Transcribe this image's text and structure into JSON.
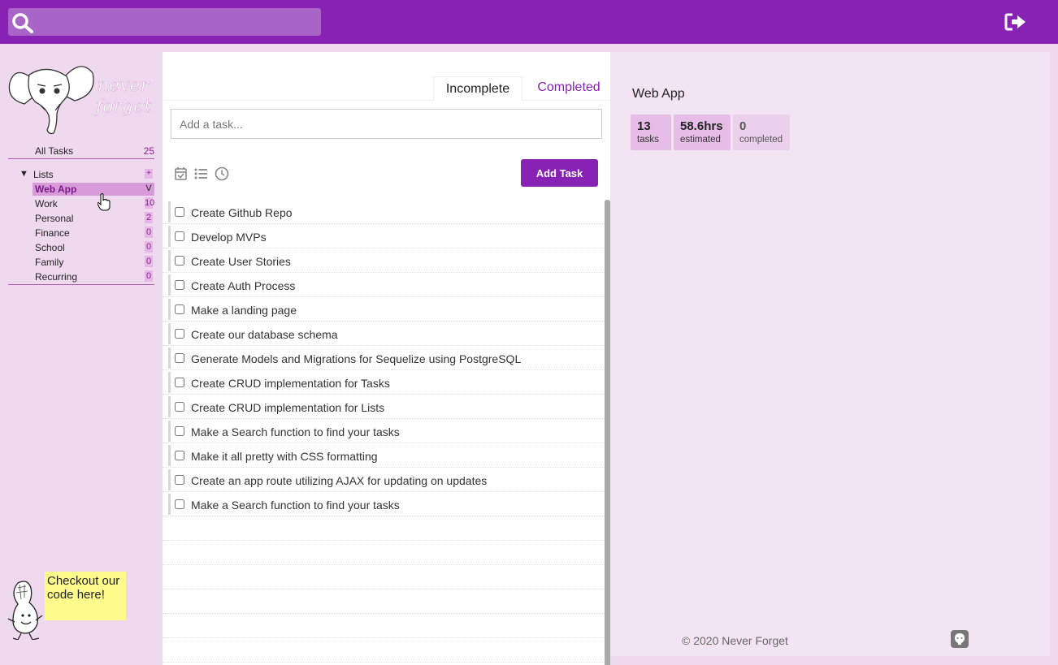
{
  "search": {
    "placeholder": ""
  },
  "sidebar": {
    "logo_text": [
      "never",
      "forget"
    ],
    "all_tasks": {
      "label": "All Tasks",
      "count": "25"
    },
    "lists_label": "Lists",
    "add_list": "+",
    "items": [
      {
        "label": "Web App",
        "count": "V"
      },
      {
        "label": "Work",
        "count": "10"
      },
      {
        "label": "Personal",
        "count": "2"
      },
      {
        "label": "Finance",
        "count": "0"
      },
      {
        "label": "School",
        "count": "0"
      },
      {
        "label": "Family",
        "count": "0"
      },
      {
        "label": "Recurring",
        "count": "0"
      }
    ],
    "code_bubble": "Checkout our code here!"
  },
  "tabs": {
    "incomplete": "Incomplete",
    "completed": "Completed"
  },
  "task_input": {
    "placeholder": "Add a task..."
  },
  "add_task_label": "Add Task",
  "tasks": [
    "Create Github Repo",
    "Develop MVPs",
    "Create User Stories",
    "Create Auth Process",
    "Make a landing page",
    "Create our database schema",
    "Generate Models and Migrations for Sequelize using PostgreSQL",
    "Create CRUD implementation for Tasks",
    "Create CRUD implementation for Lists",
    "Make a Search function to find your tasks",
    "Make it all pretty with CSS formatting",
    "Create an app route utilizing AJAX for updating on updates",
    "Make a Search function to find your tasks"
  ],
  "details": {
    "title": "Web App",
    "stats": [
      {
        "value": "13",
        "label": "tasks"
      },
      {
        "value": "58.6hrs",
        "label": "estimated"
      },
      {
        "value": "0",
        "label": "completed"
      }
    ]
  },
  "footer": "© 2020 Never Forget",
  "colors": {
    "brand": "#8822b4",
    "sidebar_bg": "#efd9ef",
    "highlight": "#d89ad8"
  },
  "icons": [
    "search-icon",
    "logout-icon",
    "calendar-check-icon",
    "list-icon",
    "clock-icon",
    "github-icon"
  ]
}
